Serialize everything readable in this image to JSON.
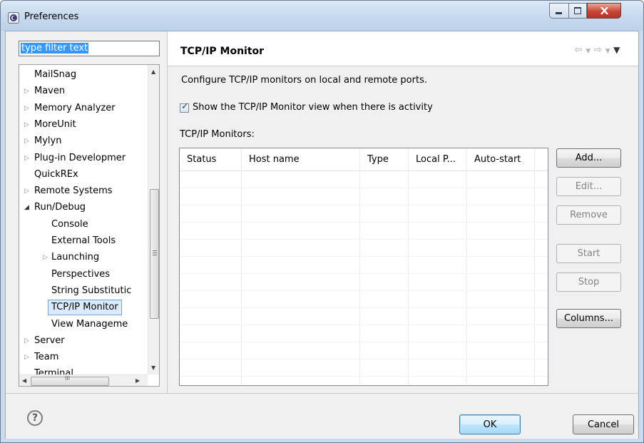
{
  "window": {
    "title": "Preferences"
  },
  "filter": {
    "text": "type filter text"
  },
  "tree": {
    "items": [
      {
        "label": "MailSnag",
        "expander": "none",
        "level": 0
      },
      {
        "label": "Maven",
        "expander": "collapsed",
        "level": 0
      },
      {
        "label": "Memory Analyzer",
        "expander": "collapsed",
        "level": 0
      },
      {
        "label": "MoreUnit",
        "expander": "collapsed",
        "level": 0
      },
      {
        "label": "Mylyn",
        "expander": "collapsed",
        "level": 0
      },
      {
        "label": "Plug-in Developmer",
        "expander": "collapsed",
        "level": 0
      },
      {
        "label": "QuickREx",
        "expander": "none",
        "level": 0
      },
      {
        "label": "Remote Systems",
        "expander": "collapsed",
        "level": 0
      },
      {
        "label": "Run/Debug",
        "expander": "expanded",
        "level": 0
      },
      {
        "label": "Console",
        "expander": "none",
        "level": 1
      },
      {
        "label": "External Tools",
        "expander": "none",
        "level": 1
      },
      {
        "label": "Launching",
        "expander": "collapsed",
        "level": 1
      },
      {
        "label": "Perspectives",
        "expander": "none",
        "level": 1
      },
      {
        "label": "String Substitutic",
        "expander": "none",
        "level": 1
      },
      {
        "label": "TCP/IP Monitor",
        "expander": "none",
        "level": 1,
        "selected": true
      },
      {
        "label": "View Manageme",
        "expander": "none",
        "level": 1
      },
      {
        "label": "Server",
        "expander": "collapsed",
        "level": 0
      },
      {
        "label": "Team",
        "expander": "collapsed",
        "level": 0
      },
      {
        "label": "Terminal",
        "expander": "none",
        "level": 0
      }
    ],
    "hscroll_grip": "III"
  },
  "page": {
    "title": "TCP/IP Monitor",
    "description": "Configure TCP/IP monitors on local and remote ports.",
    "show_view_checkbox": {
      "label": "Show the TCP/IP Monitor view when there is activity",
      "checked": true
    },
    "monitors_label": "TCP/IP Monitors:"
  },
  "table": {
    "columns": [
      "Status",
      "Host name",
      "Type",
      "Local P...",
      "Auto-start"
    ],
    "rows": []
  },
  "buttons": {
    "add": "Add...",
    "edit": "Edit...",
    "remove": "Remove",
    "start": "Start",
    "stop": "Stop",
    "columns": "Columns...",
    "ok": "OK",
    "cancel": "Cancel"
  },
  "icons": {
    "help": "?",
    "nav": [
      "back-arrow-icon",
      "dropdown-icon",
      "forward-arrow-icon",
      "dropdown-icon",
      "view-menu-icon"
    ]
  },
  "colors": {
    "selection": "#3399ff",
    "selected_tree_item": "#dcebfc",
    "close_button": "#c74536"
  }
}
